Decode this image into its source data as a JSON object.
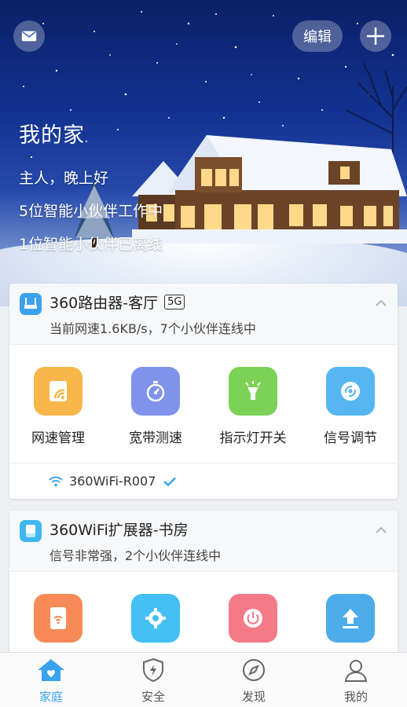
{
  "header": {
    "edit_label": "编辑",
    "home_title": "我的家",
    "greeting": "主人，晚上好",
    "online_line": "5位智能小伙伴工作中",
    "offline_line": "1位智能小伙伴已离线"
  },
  "devices": [
    {
      "name": "360路由器-客厅",
      "badge": "5G",
      "status": "当前网速1.6KB/s，7个小伙伴连线中",
      "functions": [
        {
          "label": "网速管理",
          "icon": "speed-manage-icon",
          "color": "#f9b64a"
        },
        {
          "label": "宽带测速",
          "icon": "stopwatch-icon",
          "color": "#7f93ea"
        },
        {
          "label": "指示灯开关",
          "icon": "indicator-light-icon",
          "color": "#7cd157"
        },
        {
          "label": "信号调节",
          "icon": "signal-adjust-icon",
          "color": "#55b6f2"
        }
      ],
      "wifi_name": "360WiFi-R007"
    },
    {
      "name": "360WiFi扩展器-书房",
      "status": "信号非常强，2个小伙伴连线中",
      "functions": [
        {
          "icon": "extender-wifi-icon",
          "color": "#f88a58"
        },
        {
          "icon": "gear-icon",
          "color": "#44c0f4"
        },
        {
          "icon": "power-icon",
          "color": "#f57a88"
        },
        {
          "icon": "upload-icon",
          "color": "#4cace9"
        }
      ]
    }
  ],
  "tabs": [
    {
      "label": "家庭",
      "icon": "home-icon",
      "active": true
    },
    {
      "label": "安全",
      "icon": "shield-icon",
      "active": false
    },
    {
      "label": "发现",
      "icon": "compass-icon",
      "active": false
    },
    {
      "label": "我的",
      "icon": "person-icon",
      "active": false
    }
  ],
  "colors": {
    "accent": "#3aa2ee",
    "sky_top": "#0a1f66",
    "tab_inactive": "#555555"
  }
}
